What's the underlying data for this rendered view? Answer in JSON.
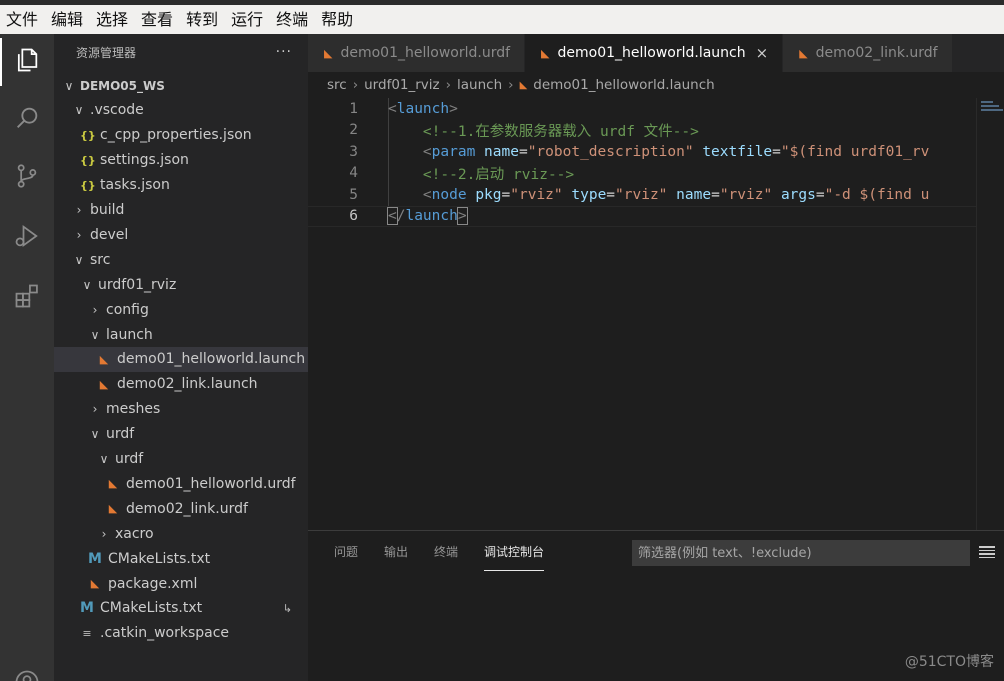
{
  "menubar": [
    "文件",
    "编辑",
    "选择",
    "查看",
    "转到",
    "运行",
    "终端",
    "帮助"
  ],
  "activity": {
    "icons": [
      "explorer-icon",
      "search-icon",
      "source-control-icon",
      "run-debug-icon",
      "extensions-icon",
      "accounts-icon"
    ]
  },
  "sidebar": {
    "title": "资源管理器",
    "more": "···",
    "items": [
      {
        "label": "DEMO05_WS",
        "depth": 0,
        "kind": "folder-open",
        "root": true
      },
      {
        "label": ".vscode",
        "depth": 1,
        "kind": "folder-open"
      },
      {
        "label": "c_cpp_properties.json",
        "depth": 2,
        "kind": "json"
      },
      {
        "label": "settings.json",
        "depth": 2,
        "kind": "json"
      },
      {
        "label": "tasks.json",
        "depth": 2,
        "kind": "json"
      },
      {
        "label": "build",
        "depth": 1,
        "kind": "folder-closed"
      },
      {
        "label": "devel",
        "depth": 1,
        "kind": "folder-closed"
      },
      {
        "label": "src",
        "depth": 1,
        "kind": "folder-open"
      },
      {
        "label": "urdf01_rviz",
        "depth": 2,
        "kind": "folder-open"
      },
      {
        "label": "config",
        "depth": 3,
        "kind": "folder-closed"
      },
      {
        "label": "launch",
        "depth": 3,
        "kind": "folder-open"
      },
      {
        "label": "demo01_helloworld.launch",
        "depth": 4,
        "kind": "rss",
        "selected": true
      },
      {
        "label": "demo02_link.launch",
        "depth": 4,
        "kind": "rss"
      },
      {
        "label": "meshes",
        "depth": 3,
        "kind": "folder-closed"
      },
      {
        "label": "urdf",
        "depth": 3,
        "kind": "folder-open"
      },
      {
        "label": "urdf",
        "depth": 4,
        "kind": "folder-open"
      },
      {
        "label": "demo01_helloworld.urdf",
        "depth": 5,
        "kind": "rss"
      },
      {
        "label": "demo02_link.urdf",
        "depth": 5,
        "kind": "rss"
      },
      {
        "label": "xacro",
        "depth": 4,
        "kind": "folder-closed"
      },
      {
        "label": "CMakeLists.txt",
        "depth": 3,
        "kind": "cmake"
      },
      {
        "label": "package.xml",
        "depth": 3,
        "kind": "rss"
      },
      {
        "label": "CMakeLists.txt",
        "depth": 2,
        "kind": "cmake",
        "git": "↳"
      },
      {
        "label": ".catkin_workspace",
        "depth": 2,
        "kind": "catkin"
      }
    ]
  },
  "tabs": [
    {
      "label": "demo01_helloworld.urdf",
      "active": false
    },
    {
      "label": "demo01_helloworld.launch",
      "active": true,
      "close": "×"
    },
    {
      "label": "demo02_link.urdf",
      "active": false
    }
  ],
  "breadcrumb": [
    "src",
    "urdf01_rviz",
    "launch",
    "demo01_helloworld.launch"
  ],
  "editor": {
    "current_line": 6,
    "lines": [
      {
        "n": "1",
        "tokens": [
          [
            "t-tag",
            "<"
          ],
          [
            "t-name",
            "launch"
          ],
          [
            "t-tag",
            ">"
          ]
        ]
      },
      {
        "n": "2",
        "tokens": [
          [
            "",
            "    "
          ],
          [
            "t-com",
            "<!--1.在参数服务器载入 urdf 文件-->"
          ]
        ]
      },
      {
        "n": "3",
        "tokens": [
          [
            "",
            "    "
          ],
          [
            "t-tag",
            "<"
          ],
          [
            "t-name",
            "param"
          ],
          [
            "",
            " "
          ],
          [
            "t-attr",
            "name"
          ],
          [
            "t-eq",
            "="
          ],
          [
            "t-str",
            "\"robot_description\""
          ],
          [
            "",
            " "
          ],
          [
            "t-attr",
            "textfile"
          ],
          [
            "t-eq",
            "="
          ],
          [
            "t-str",
            "\"$(find urdf01_rv"
          ]
        ]
      },
      {
        "n": "4",
        "tokens": [
          [
            "",
            "    "
          ],
          [
            "t-com",
            "<!--2.启动 rviz-->"
          ]
        ]
      },
      {
        "n": "5",
        "tokens": [
          [
            "",
            "    "
          ],
          [
            "t-tag",
            "<"
          ],
          [
            "t-name",
            "node"
          ],
          [
            "",
            " "
          ],
          [
            "t-attr",
            "pkg"
          ],
          [
            "t-eq",
            "="
          ],
          [
            "t-str",
            "\"rviz\""
          ],
          [
            "",
            " "
          ],
          [
            "t-attr",
            "type"
          ],
          [
            "t-eq",
            "="
          ],
          [
            "t-str",
            "\"rviz\""
          ],
          [
            "",
            " "
          ],
          [
            "t-attr",
            "name"
          ],
          [
            "t-eq",
            "="
          ],
          [
            "t-str",
            "\"rviz\""
          ],
          [
            "",
            " "
          ],
          [
            "t-attr",
            "args"
          ],
          [
            "t-eq",
            "="
          ],
          [
            "t-str",
            "\"-d $(find u"
          ]
        ]
      },
      {
        "n": "6",
        "tokens": [
          [
            "t-tag bracket-hl",
            "<"
          ],
          [
            "t-tag",
            "/"
          ],
          [
            "t-name",
            "launch"
          ],
          [
            "t-tag bracket-hl",
            ">"
          ]
        ]
      }
    ]
  },
  "panel": {
    "tabs": [
      "问题",
      "输出",
      "终端",
      "调试控制台"
    ],
    "active_tab": 3,
    "filter_placeholder": "筛选器(例如 text、!exclude)"
  },
  "watermark": "@51CTO博客"
}
